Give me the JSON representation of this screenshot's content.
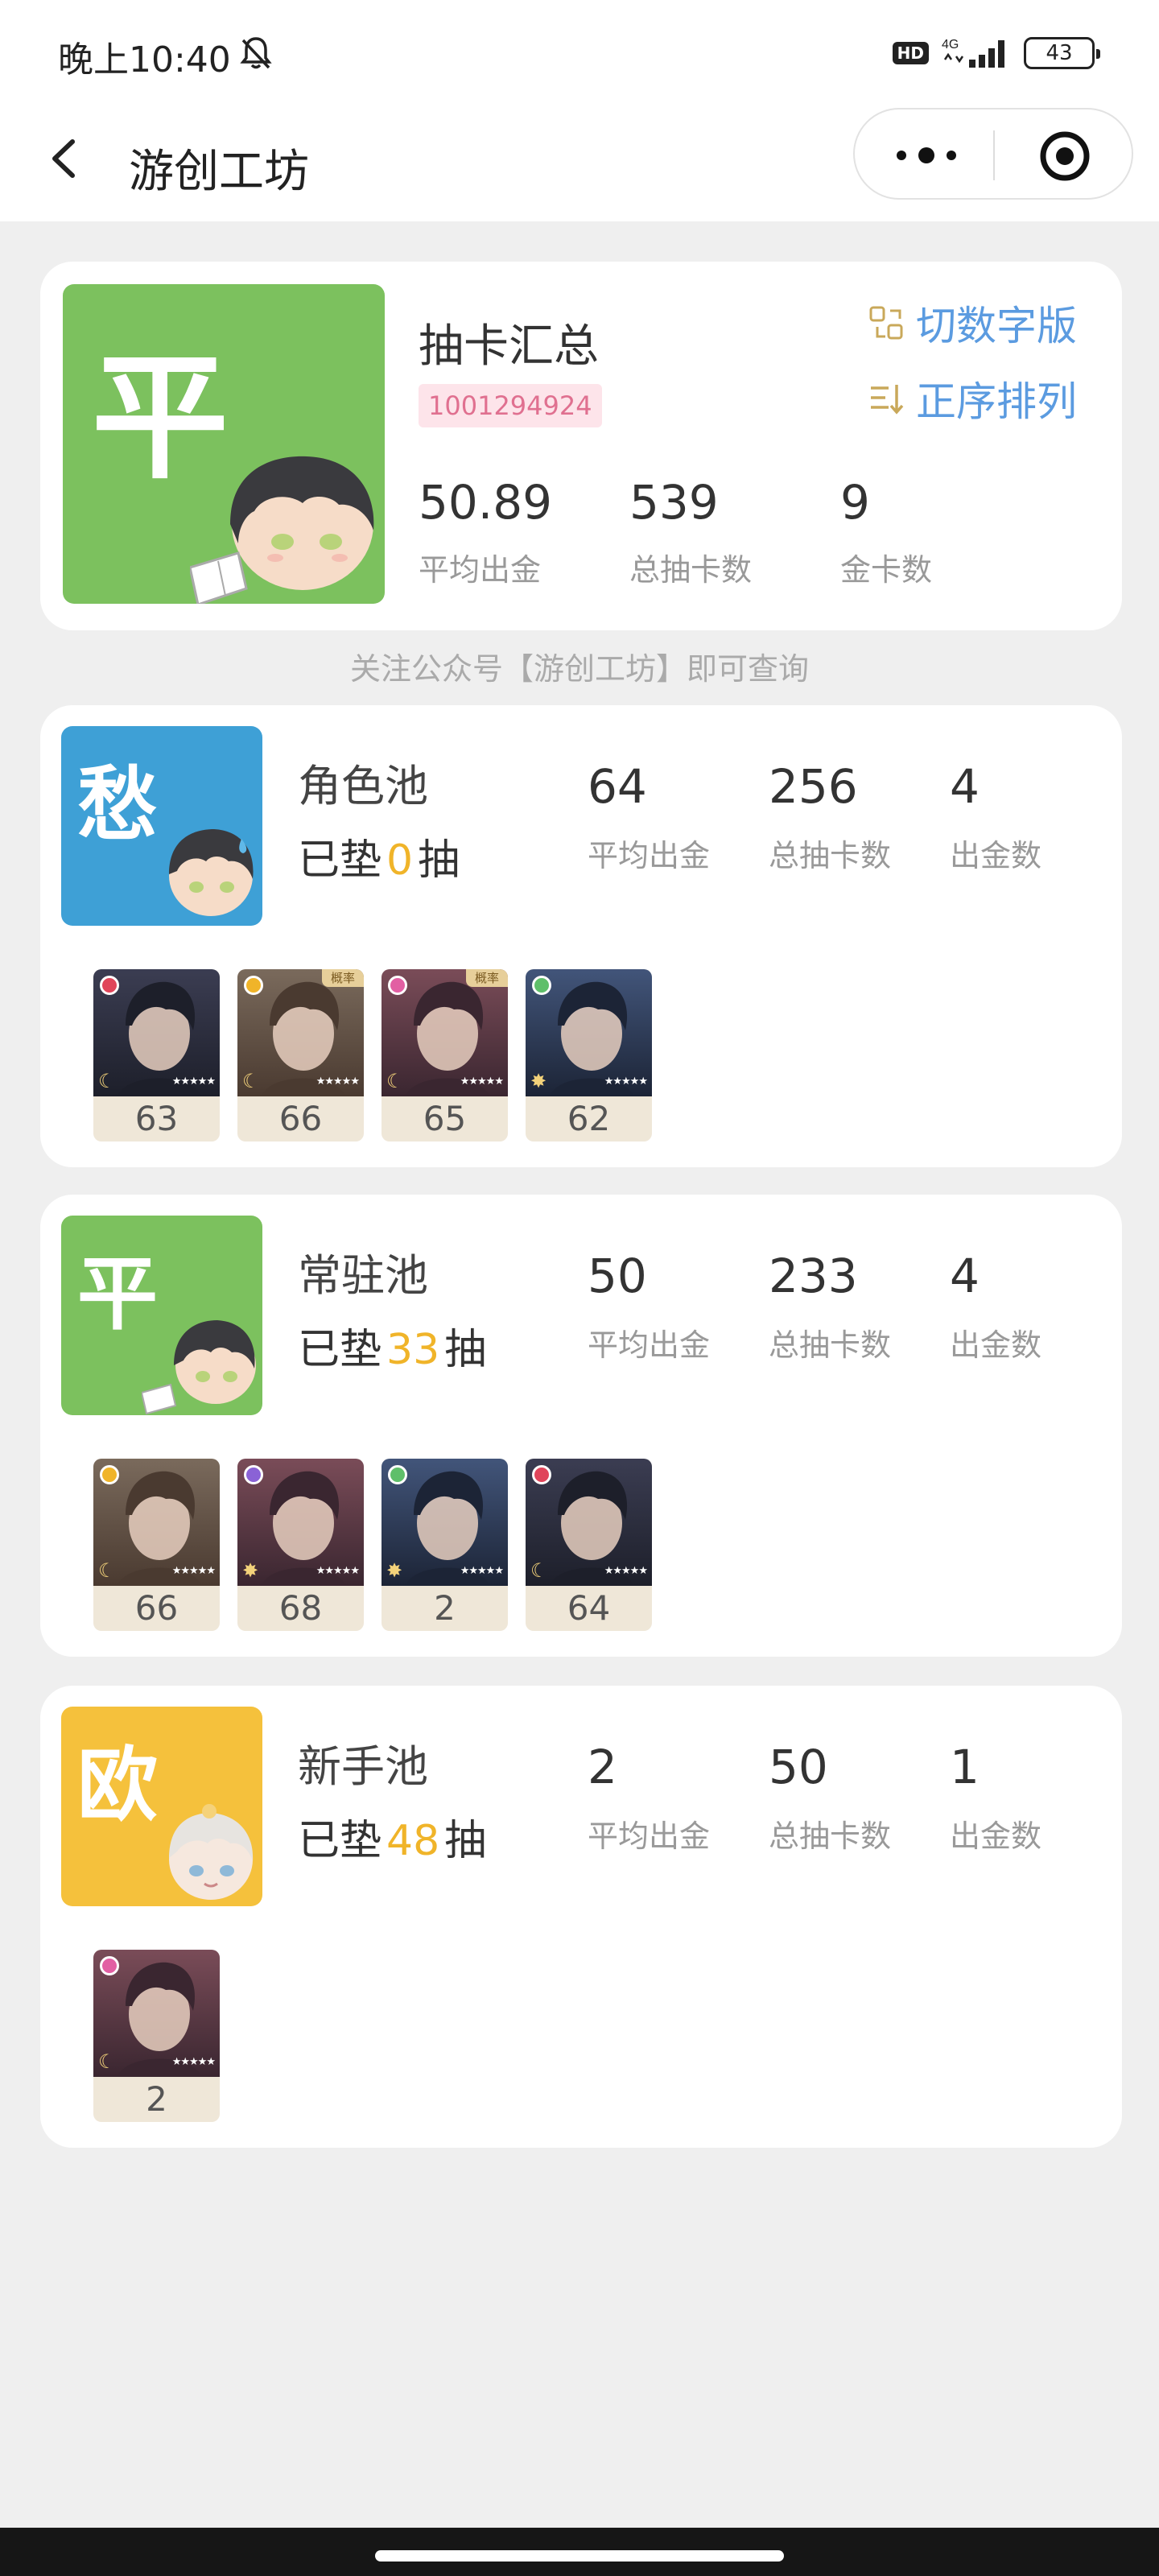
{
  "status_bar": {
    "time": "晚上10:40",
    "hd": "HD",
    "network": "4G",
    "battery": "43"
  },
  "nav": {
    "title": "游创工坊"
  },
  "summary": {
    "avatar_char": "平",
    "title": "抽卡汇总",
    "uid": "1001294924",
    "actions": [
      {
        "label": "切数字版",
        "icon": "swap-icon"
      },
      {
        "label": "正序排列",
        "icon": "sort-icon"
      }
    ],
    "stats": [
      {
        "value": "50.89",
        "label": "平均出金"
      },
      {
        "value": "539",
        "label": "总抽卡数"
      },
      {
        "value": "9",
        "label": "金卡数"
      }
    ]
  },
  "notice": "关注公众号【游创工坊】即可查询",
  "pools": [
    {
      "avatar_char": "愁",
      "avatar_color": "#3ea0d6",
      "name": "角色池",
      "pity_prefix": "已垫",
      "pity": "0",
      "pity_suffix": "抽",
      "stats": [
        {
          "value": "64",
          "label": "平均出金"
        },
        {
          "value": "256",
          "label": "总抽卡数"
        },
        {
          "value": "4",
          "label": "出金数"
        }
      ],
      "cards": [
        {
          "num": "63",
          "gem": "#e0455a",
          "tag": "",
          "icon": "moon-icon"
        },
        {
          "num": "66",
          "gem": "#f0b429",
          "tag": "概率",
          "icon": "moon-icon"
        },
        {
          "num": "65",
          "gem": "#e25fa3",
          "tag": "概率",
          "icon": "moon-icon"
        },
        {
          "num": "62",
          "gem": "#5fbf6a",
          "tag": "",
          "icon": "sun-icon"
        }
      ]
    },
    {
      "avatar_char": "平",
      "avatar_color": "#7cc15e",
      "name": "常驻池",
      "pity_prefix": "已垫",
      "pity": "33",
      "pity_suffix": "抽",
      "stats": [
        {
          "value": "50",
          "label": "平均出金"
        },
        {
          "value": "233",
          "label": "总抽卡数"
        },
        {
          "value": "4",
          "label": "出金数"
        }
      ],
      "cards": [
        {
          "num": "66",
          "gem": "#f0b429",
          "tag": "",
          "icon": "moon-icon"
        },
        {
          "num": "68",
          "gem": "#8a62d6",
          "tag": "",
          "icon": "sun-icon"
        },
        {
          "num": "2",
          "gem": "#5fbf6a",
          "tag": "",
          "icon": "sun-icon"
        },
        {
          "num": "64",
          "gem": "#e0455a",
          "tag": "",
          "icon": "moon-icon"
        }
      ]
    },
    {
      "avatar_char": "欧",
      "avatar_color": "#f5c13c",
      "name": "新手池",
      "pity_prefix": "已垫",
      "pity": "48",
      "pity_suffix": "抽",
      "stats": [
        {
          "value": "2",
          "label": "平均出金"
        },
        {
          "value": "50",
          "label": "总抽卡数"
        },
        {
          "value": "1",
          "label": "出金数"
        }
      ],
      "cards": [
        {
          "num": "2",
          "gem": "#e25fa3",
          "tag": "",
          "icon": "moon-icon"
        }
      ]
    }
  ]
}
